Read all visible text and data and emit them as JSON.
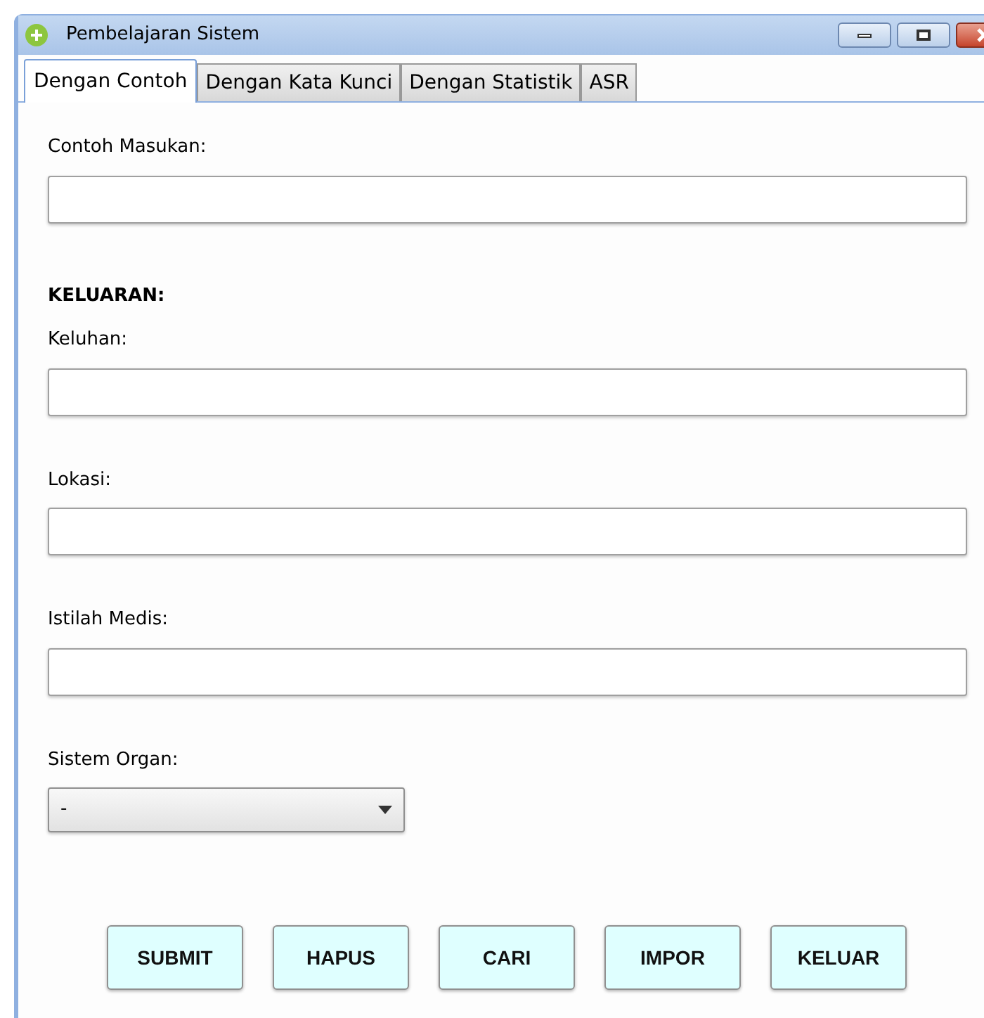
{
  "window": {
    "title": "Pembelajaran Sistem"
  },
  "tabs": [
    {
      "label": "Dengan Contoh",
      "selected": true
    },
    {
      "label": "Dengan Kata Kunci",
      "selected": false
    },
    {
      "label": "Dengan Statistik",
      "selected": false
    },
    {
      "label": "ASR",
      "selected": false
    }
  ],
  "form": [
    {
      "kind": "field",
      "label": "Contoh Masukan:"
    },
    {
      "kind": "heading",
      "label": "KELUARAN:"
    },
    {
      "kind": "field",
      "label": "Keluhan:"
    },
    {
      "kind": "field",
      "label": "Lokasi:"
    },
    {
      "kind": "field",
      "label": "Istilah Medis:"
    },
    {
      "kind": "select",
      "label": "Sistem Organ:",
      "value": "-"
    }
  ],
  "buttons": [
    "SUBMIT",
    "HAPUS",
    "CARI",
    "IMPOR",
    "KELUAR"
  ]
}
